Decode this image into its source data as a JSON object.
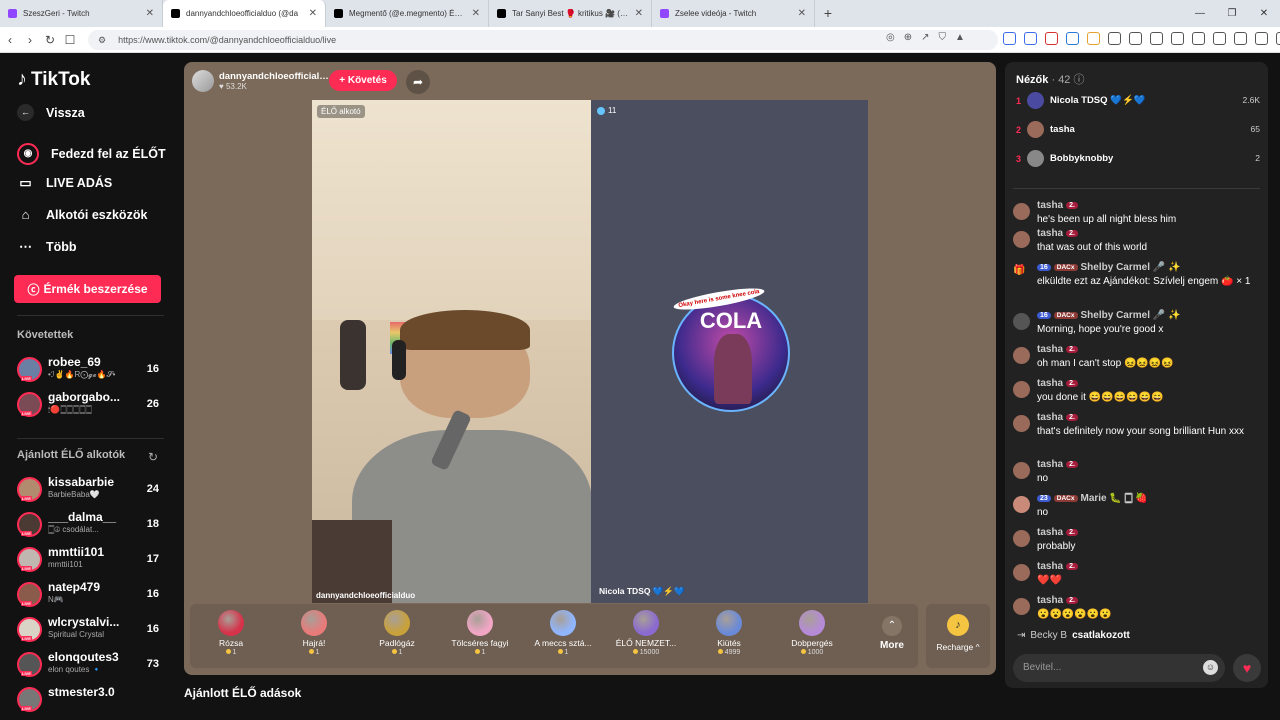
{
  "browser": {
    "tabs": [
      {
        "title": "SzeszGeri - Twitch",
        "color": "#9146ff"
      },
      {
        "title": "dannyandchloeofficialduo (@da",
        "color": "#000000"
      },
      {
        "title": "Megmentő (@e.megmento) ÉLŐ adás",
        "color": "#000000"
      },
      {
        "title": "Tar Sanyi Best 🥊 kritikus 🎥 (@szop",
        "color": "#000000"
      },
      {
        "title": "Zselee videója - Twitch",
        "color": "#9146ff"
      }
    ],
    "url": "https://www.tiktok.com/@dannyandchloeofficialduo/live"
  },
  "sidebar": {
    "brand": "TikTok",
    "back": "Vissza",
    "nav": [
      {
        "label": "Fedezd fel az ÉLŐT",
        "icon": "explore-live-icon"
      },
      {
        "label": "LIVE ADÁS",
        "icon": "live-video-icon"
      },
      {
        "label": "Alkotói eszközök",
        "icon": "creator-tools-icon"
      },
      {
        "label": "Több",
        "icon": "more-dots-icon"
      }
    ],
    "coins_button": "Érmék beszerzése",
    "following_header": "Követettek",
    "following": [
      {
        "name": "robee_69",
        "sub": "•ℐ✌🔥R⨀𝓰𝓮🔥𝓢•",
        "count": "16",
        "color": "#6a7fa3"
      },
      {
        "name": "gaborgabo...",
        "sub": "🕯🔴🀆🀆🀆🀆🀆",
        "count": "26",
        "color": "#7a4a55"
      }
    ],
    "recommended_header": "Ajánlott ÉLŐ alkotók",
    "recommended": [
      {
        "name": "kissabarbie",
        "sub": "BarbieBaba🤍",
        "count": "24",
        "color": "#b28b6f"
      },
      {
        "name": "___dalma__",
        "sub": "🀆☮ csodálat...",
        "count": "18",
        "color": "#4a3a33"
      },
      {
        "name": "mmttii101",
        "sub": "mmttii101",
        "count": "17",
        "color": "#c0b8b0"
      },
      {
        "name": "natep479",
        "sub": "N🎮",
        "count": "16",
        "color": "#8a5a4a"
      },
      {
        "name": "wlcrystalvi...",
        "sub": "Spiritual Crystal",
        "count": "16",
        "color": "#d9d4c5"
      },
      {
        "name": "elonqoutes3",
        "sub": "elon qoutes 🔹",
        "count": "73",
        "color": "#555555"
      },
      {
        "name": "stmester3.0",
        "sub": "",
        "count": "",
        "color": "#777777"
      }
    ]
  },
  "stream": {
    "host_name": "dannyandchloeofficialduo",
    "host_likes": "♥ 53.2K",
    "follow_label": "+ Követés",
    "left_badge": "ÉLŐ alkotó",
    "left_name": "dannyandchloeofficialduo",
    "right_count": "11",
    "right_logo_text": "COLA",
    "right_bubble": "Okay here is some knee cola",
    "right_name": "Nicola TDSQ 💙⚡💙"
  },
  "gifts": [
    {
      "name": "Rózsa",
      "price": "1",
      "color": "#d6324a"
    },
    {
      "name": "Hajrá!",
      "price": "1",
      "color": "#e87a7a"
    },
    {
      "name": "Padlógáz",
      "price": "1",
      "color": "#c9a13a"
    },
    {
      "name": "Tölcséres fagyi",
      "price": "1",
      "color": "#f2a6c6"
    },
    {
      "name": "A meccs sztá...",
      "price": "1",
      "color": "#8fb6ff"
    },
    {
      "name": "ÉLŐ NEMZET...",
      "price": "15000",
      "color": "#8a6ad0"
    },
    {
      "name": "Kiütés",
      "price": "4999",
      "color": "#6a8ad8"
    },
    {
      "name": "Dobpergés",
      "price": "1000",
      "color": "#b58ad8"
    }
  ],
  "more_label": "More",
  "recharge_label": "Recharge ^",
  "recommended_streams": "Ajánlott ÉLŐ adások",
  "chat": {
    "viewers_label": "Nézők",
    "viewers_count": "· 42",
    "top_viewers": [
      {
        "rank": "1",
        "name": "Nicola TDSQ 💙⚡💙",
        "score": "2.6K",
        "color": "#4a4aa0"
      },
      {
        "rank": "2",
        "name": "tasha",
        "score": "65",
        "color": "#9a6a5a"
      },
      {
        "rank": "3",
        "name": "Bobbyknobby",
        "score": "2",
        "color": "#888888"
      }
    ],
    "messages": [
      {
        "user": "tasha",
        "level": "2.",
        "text": "he's been up all night bless him",
        "color": "#9a6a5a"
      },
      {
        "user": "tasha",
        "level": "2.",
        "text": "that was out of this world",
        "color": "#9a6a5a"
      },
      {
        "user": "Shelby Carmel 🎤 ✨",
        "level": "16",
        "fan": "DACx",
        "text": "elküldte ezt az Ajándékot: Szívlelj engem 🍅 × 1",
        "color": "#333333"
      },
      {
        "user": "Shelby Carmel 🎤 ✨",
        "level": "16",
        "fan": "DACx",
        "text": "Morning, hope you're good x",
        "color": "#555555"
      },
      {
        "user": "tasha",
        "level": "2.",
        "text": "oh man I can't stop 😖😖😖😖",
        "color": "#9a6a5a"
      },
      {
        "user": "tasha",
        "level": "2.",
        "text": "you done it 😄😄😄😄😄😄",
        "color": "#9a6a5a"
      },
      {
        "user": "tasha",
        "level": "2.",
        "text": "that's definitely now your song brilliant Hun xxx",
        "color": "#9a6a5a"
      },
      {
        "user": "tasha",
        "level": "2.",
        "text": "no",
        "color": "#9a6a5a"
      },
      {
        "user": "Marie 🐛 🀆 🍓",
        "level": "23",
        "fan": "DACx",
        "text": "no",
        "color": "#c98a7a"
      },
      {
        "user": "tasha",
        "level": "2.",
        "text": "probably",
        "color": "#9a6a5a"
      },
      {
        "user": "tasha",
        "level": "2.",
        "text": "❤️❤️",
        "color": "#9a6a5a"
      },
      {
        "user": "tasha",
        "level": "2.",
        "text": "😮😮😮😮😮😮",
        "color": "#9a6a5a"
      }
    ],
    "joined_user": "Becky B",
    "joined_text": "csatlakozott",
    "input_placeholder": "Bevitel..."
  }
}
